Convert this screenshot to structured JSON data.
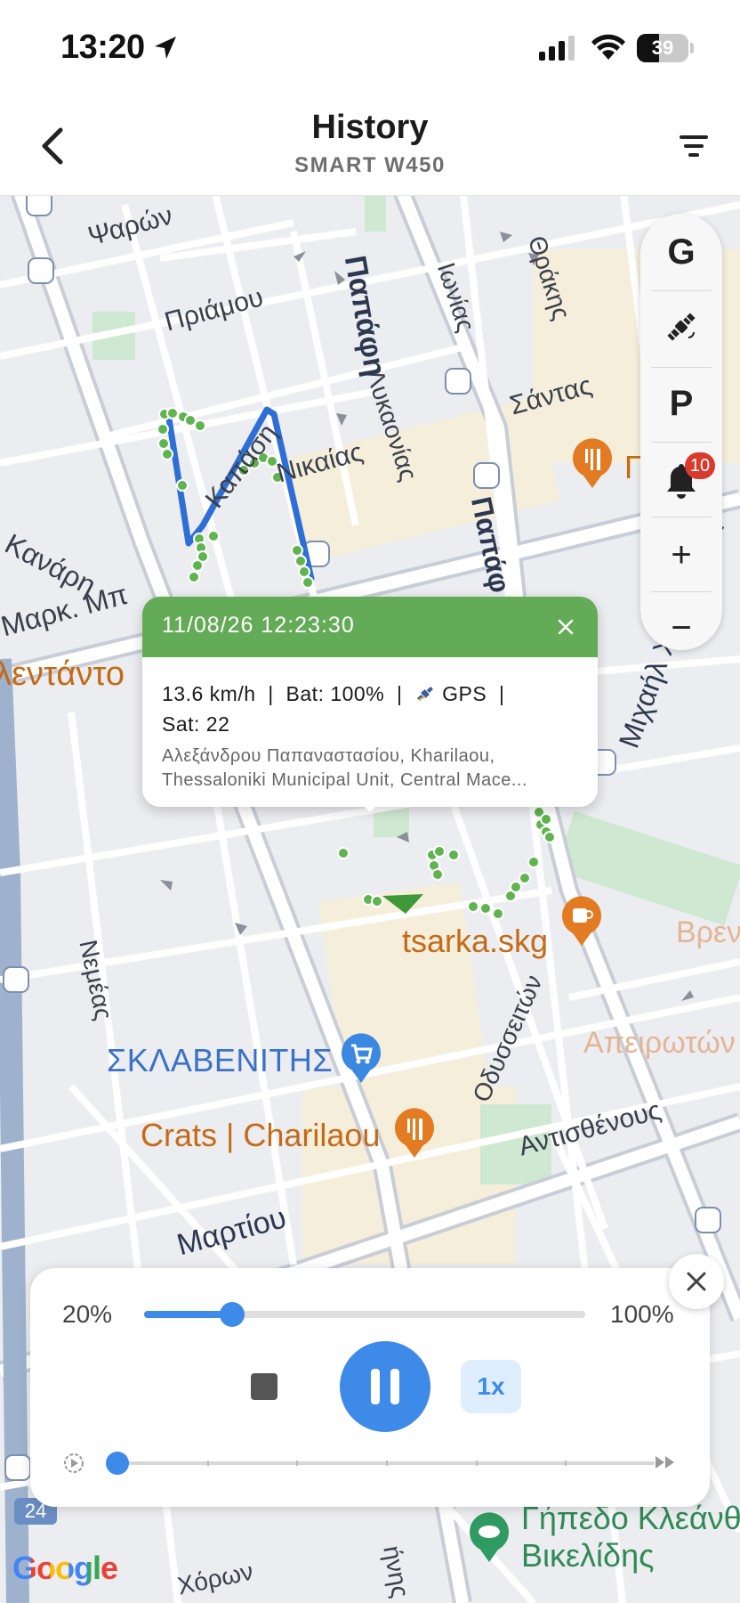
{
  "status_bar": {
    "time": "13:20",
    "battery": "39",
    "icons": [
      "location-arrow-icon",
      "cellular-signal-icon",
      "wifi-icon",
      "battery-icon"
    ]
  },
  "header": {
    "title": "History",
    "subtitle": "SMART W450",
    "back_icon": "chevron-left-icon",
    "filter_icon": "filter-icon"
  },
  "map": {
    "street_labels": [
      "Ψαρών",
      "Πριάμου",
      "Καπάση",
      "Ιωνίας",
      "Θράκης",
      "Λυκαονίας",
      "Σάντας",
      "Νικαίας",
      "Κανάρη",
      "Μαρκ. Μπ",
      "Παπάφη",
      "Παπάφ",
      "λεντάντο",
      "Μιχαήλ Χουρμούζη",
      "Νεμέας",
      "Οδυσσειτών",
      "Αντισθένους",
      "Μαρτίου",
      "Απειρωτών",
      "Βρεν",
      "ήνης",
      "Χόρων",
      "Γήπεδο Κλεάνθ Βικελίδης"
    ],
    "pois": [
      {
        "name": "tsarka.skg",
        "kind": "coffee-icon"
      },
      {
        "name": "ΣΚΛΑΒΕΝΙΤΗΣ",
        "kind": "cart-icon"
      },
      {
        "name": "Crats | Charilaou",
        "kind": "restaurant-icon"
      },
      {
        "name": "Γήπεδο Κλεάνθ",
        "name2": "Βικελίδης",
        "kind": "stadium-icon"
      },
      {
        "name": "Γ",
        "kind": "restaurant-icon"
      }
    ],
    "route_badge": "24",
    "attribution": "Google",
    "colors": {
      "route": "#2d6fd6",
      "points": "#5fb44f",
      "accent": "#3d8ae8"
    }
  },
  "controls": {
    "g_label": "G",
    "satellite_icon": "satellite-icon",
    "p_label": "P",
    "bell_icon": "bell-icon",
    "bell_badge": "10",
    "zoom_in": "+",
    "zoom_out": "−"
  },
  "popup": {
    "datetime": "11/08/26 12:23:30",
    "speed": "13.6 km/h",
    "sep": "|",
    "battery": "Bat: 100%",
    "gps": "GPS",
    "satellites": "Sat: 22",
    "address": "Αλεξάνδρου Παπαναστασίου, Kharilaou, Thessaloniki Municipal Unit, Central Mace..."
  },
  "playback": {
    "range_min": "20%",
    "range_max": "100%",
    "range_value": 0.2,
    "speed": "1x",
    "progress_value": 0.0,
    "progress_ticks": 5
  }
}
